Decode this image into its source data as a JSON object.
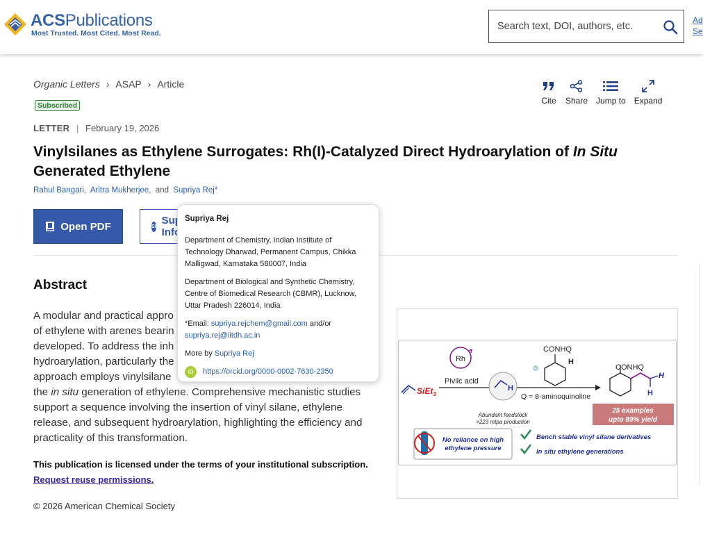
{
  "header": {
    "logo_title_bold": "ACS",
    "logo_title_rest": "Publications",
    "logo_tagline": "Most Trusted. Most Cited. Most Read.",
    "search_placeholder": "Search text, DOI, authors, etc.",
    "advanced_line1": "Ad",
    "advanced_line2": "Se"
  },
  "breadcrumb": {
    "journal": "Organic Letters",
    "issue": "ASAP",
    "type": "Article"
  },
  "badge": "Subscribed",
  "toolbar": {
    "cite": "Cite",
    "share": "Share",
    "jump": "Jump to",
    "expand": "Expand"
  },
  "meta": {
    "type": "LETTER",
    "separator": "|",
    "date": "February 19, 2026"
  },
  "title": {
    "part1": "Vinylsilanes as Ethylene Surrogates: Rh(I)-Catalyzed Direct Hydroarylation of ",
    "part2_italic": "In Situ",
    "part3": "Generated Ethylene"
  },
  "authors": {
    "a1": "Rahul Bangari,",
    "a2": "Aritra Mukherjee,",
    "and": "and",
    "a3": "Supriya Rej*"
  },
  "buttons": {
    "pdf": "Open PDF",
    "si_icon": "SI",
    "si_label": "Supporting Information"
  },
  "abstract": {
    "heading": "Abstract",
    "line1": "A modular and practical appro",
    "line2": "of ethylene with arenes bearin",
    "line3": "developed. To address the inh",
    "line4": "hydroarylation, particularly the",
    "line5": "approach employs vinylsilane",
    "line6_pre": "the ",
    "line6_it": "in situ",
    "line6_post": " generation of ethylene. Comprehensive mechanistic studies",
    "line7": "support a sequence involving the insertion of vinyl silane, ethylene",
    "line8": "release, and subsequent hydroarylation, highlighting the efficiency and",
    "line9": "practicality of this transformation."
  },
  "license": "This publication is licensed under the terms of your institutional subscription.",
  "reuse": "Request reuse permissions.",
  "copyright": "© 2026 American Chemical Society",
  "popover": {
    "name": "Supriya Rej",
    "aff1": "Department of Chemistry, Indian Institute of Technology Dharwad, Permanent Campus, Chikka Malligwad, Karnataka 580007, India",
    "aff2": "Department of Biological and Synthetic Chemistry, Centre of Biomedical Research (CBMR), Lucknow, Uttar Pradesh 226014, India",
    "email_label": "*Email:",
    "email1": "supriya.rejchem@gmail.com",
    "andor": "and/or",
    "email2": "supriya.rej@iitdh.ac.in",
    "more_by": "More by",
    "more_by_name": "Supriya Rej",
    "orcid_icon": "iD",
    "orcid": "https://orcid.org/0000-0002-7630-2350"
  },
  "toc": {
    "catalyst": "Rh",
    "acid": "Pivilc acid",
    "reagent": "SiEt",
    "reagent_sub": "3",
    "top_group": "CONHQ",
    "h_top": "H",
    "h_mid": "H",
    "q_def": "Q = 8-aminoquinoline",
    "feedstock1": "Abundant feedstock",
    "feedstock2": ">223 mtpa production",
    "product_group": "CONHQ",
    "prod_h1": "H",
    "prod_h2": "H",
    "examples": "25 examples",
    "yield": "upto 89% yield",
    "no_reliance1": "No reliance on high",
    "no_reliance2": "ethylene pressure",
    "bullet1": "Bench stable vinyl silane derivatives",
    "bullet2": "In situ ethylene generations",
    "colors": {
      "blue": "#1f2f9e",
      "green": "#2e8b57",
      "red_box": "#c97a7a",
      "purple": "#8b1e8b",
      "cyl": "#1e6fa8"
    }
  }
}
